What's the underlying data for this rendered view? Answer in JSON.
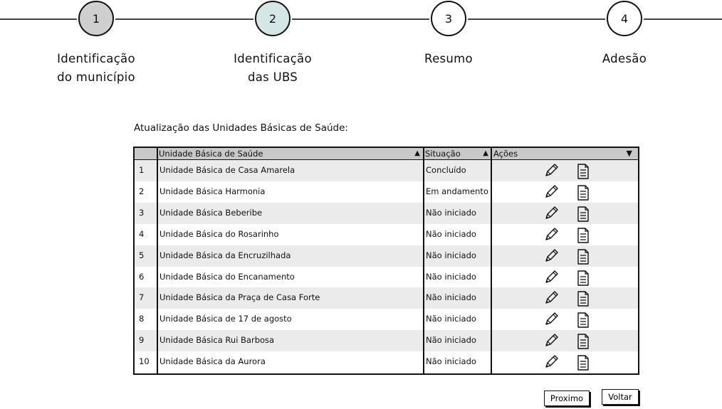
{
  "stepper": {
    "steps": [
      {
        "number": "1",
        "line1": "Identificação",
        "line2": "do município",
        "state": "done"
      },
      {
        "number": "2",
        "line1": "Identificação",
        "line2": "das UBS",
        "state": "current"
      },
      {
        "number": "3",
        "line1": "Resumo",
        "line2": "",
        "state": "pending"
      },
      {
        "number": "4",
        "line1": "Adesão",
        "line2": "",
        "state": "pending"
      }
    ]
  },
  "section": {
    "title": "Atualização das Unidades Básicas de Saúde:"
  },
  "table": {
    "columns": {
      "name": "Unidade Básica de Saúde",
      "status": "Situação",
      "actions": "Ações"
    },
    "rows": [
      {
        "index": "1",
        "name": "Unidade Básica de Casa Amarela",
        "status": "Concluído"
      },
      {
        "index": "2",
        "name": "Unidade Básica Harmonia",
        "status": "Em andamento"
      },
      {
        "index": "3",
        "name": "Unidade Básica Beberibe",
        "status": "Não iniciado"
      },
      {
        "index": "4",
        "name": "Unidade Básica do Rosarinho",
        "status": "Não iniciado"
      },
      {
        "index": "5",
        "name": "Unidade Básica da Encruzilhada",
        "status": "Não iniciado"
      },
      {
        "index": "6",
        "name": "Unidade Básica do Encanamento",
        "status": "Não iniciado"
      },
      {
        "index": "7",
        "name": "Unidade Básica da Praça de Casa Forte",
        "status": "Não iniciado"
      },
      {
        "index": "8",
        "name": "Unidade Básica de 17 de agosto",
        "status": "Não iniciado"
      },
      {
        "index": "9",
        "name": "Unidade Básica Rui Barbosa",
        "status": "Não iniciado"
      },
      {
        "index": "10",
        "name": "Unidade Básica da Aurora",
        "status": "Não iniciado"
      }
    ],
    "row_actions": [
      "pencil-icon",
      "document-icon"
    ]
  },
  "buttons": {
    "next_label": "Proximo",
    "back_label": "Voltar"
  },
  "colors": {
    "step_done": "#cfcfcf",
    "step_current": "#d5e6e6",
    "header_bg": "#c9c9c9",
    "row_alt": "#ebebeb"
  }
}
